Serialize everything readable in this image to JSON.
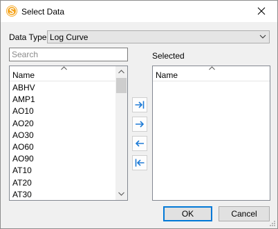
{
  "window": {
    "title": "Select Data",
    "accent": "#0078d7",
    "icon_color": "#f5a31a"
  },
  "data_type": {
    "label": "Data Type",
    "value": "Log Curve"
  },
  "search": {
    "placeholder": "Search",
    "value": ""
  },
  "available": {
    "column_header": "Name",
    "items": [
      "ABHV",
      "AMP1",
      "AO10",
      "AO20",
      "AO30",
      "AO60",
      "AO90",
      "AT10",
      "AT20",
      "AT30"
    ]
  },
  "selected": {
    "label": "Selected",
    "column_header": "Name",
    "items": []
  },
  "buttons": {
    "ok": "OK",
    "cancel": "Cancel"
  },
  "icons": {
    "app": "app-logo-icon",
    "close": "close-icon",
    "dropdown": "chevron-down-icon",
    "sort": "sort-ascending-icon",
    "move_all_right": "move-all-right-icon",
    "move_right": "move-right-icon",
    "move_left": "move-left-icon",
    "move_all_left": "move-all-left-icon"
  }
}
